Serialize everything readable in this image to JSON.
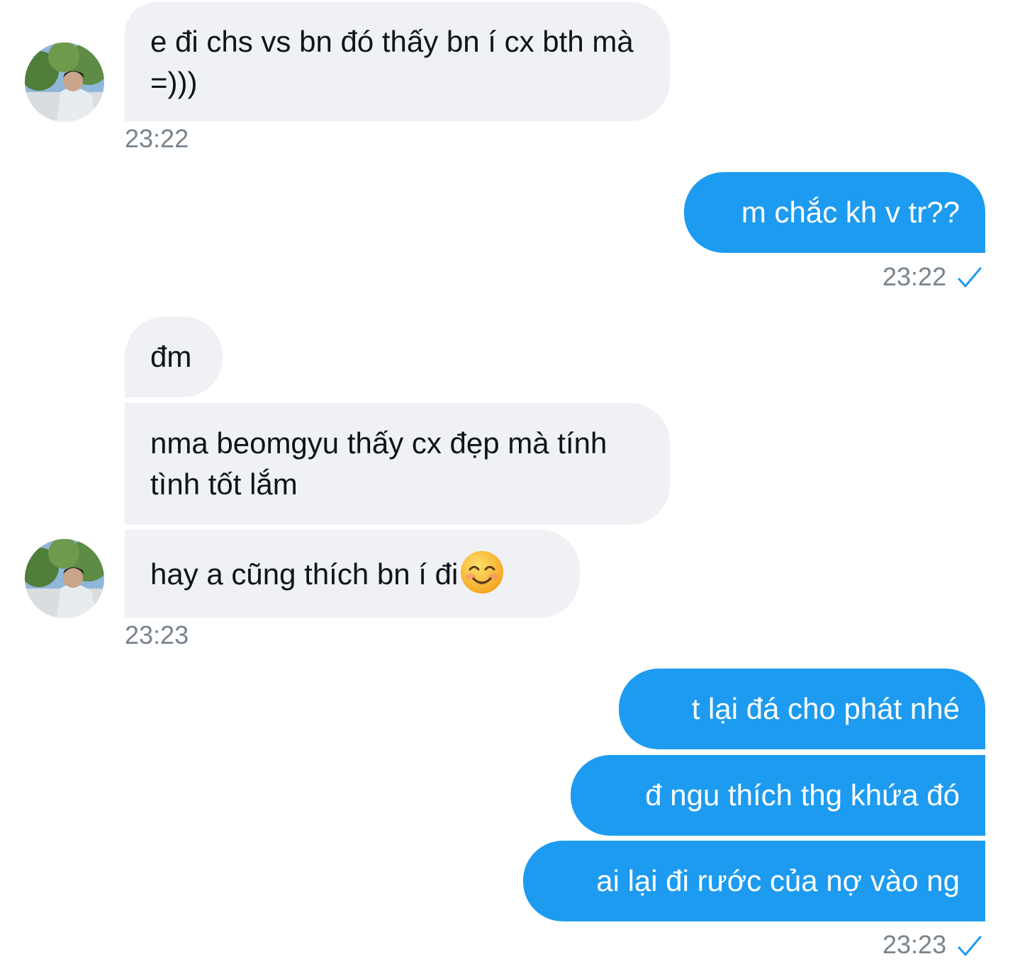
{
  "colors": {
    "incoming_bubble": "#eff1f4",
    "outgoing_bubble": "#1d9bf0",
    "timestamp": "#79838c",
    "read_check": "#1d9bf0"
  },
  "messages": [
    {
      "text": "e đi chs vs bn đó thấy bn í cx bth mà =)))"
    },
    {
      "text": "m chắc kh v tr??"
    },
    {
      "text": "đm"
    },
    {
      "text": "nma beomgyu thấy cx đẹp mà tính tình tốt lắm"
    },
    {
      "text": "hay a cũng thích bn í đi",
      "emoji": "smiling-face-with-smiling-eyes"
    },
    {
      "text": "t lại đá cho phát nhé"
    },
    {
      "text": "đ ngu thích thg khứa đó"
    },
    {
      "text": "ai lại đi rước của nợ vào ng"
    }
  ],
  "timestamps": [
    "23:22",
    "23:22",
    "23:23",
    "23:23"
  ],
  "icons": {
    "avatar": "user-avatar",
    "read_receipt": "check-icon"
  }
}
